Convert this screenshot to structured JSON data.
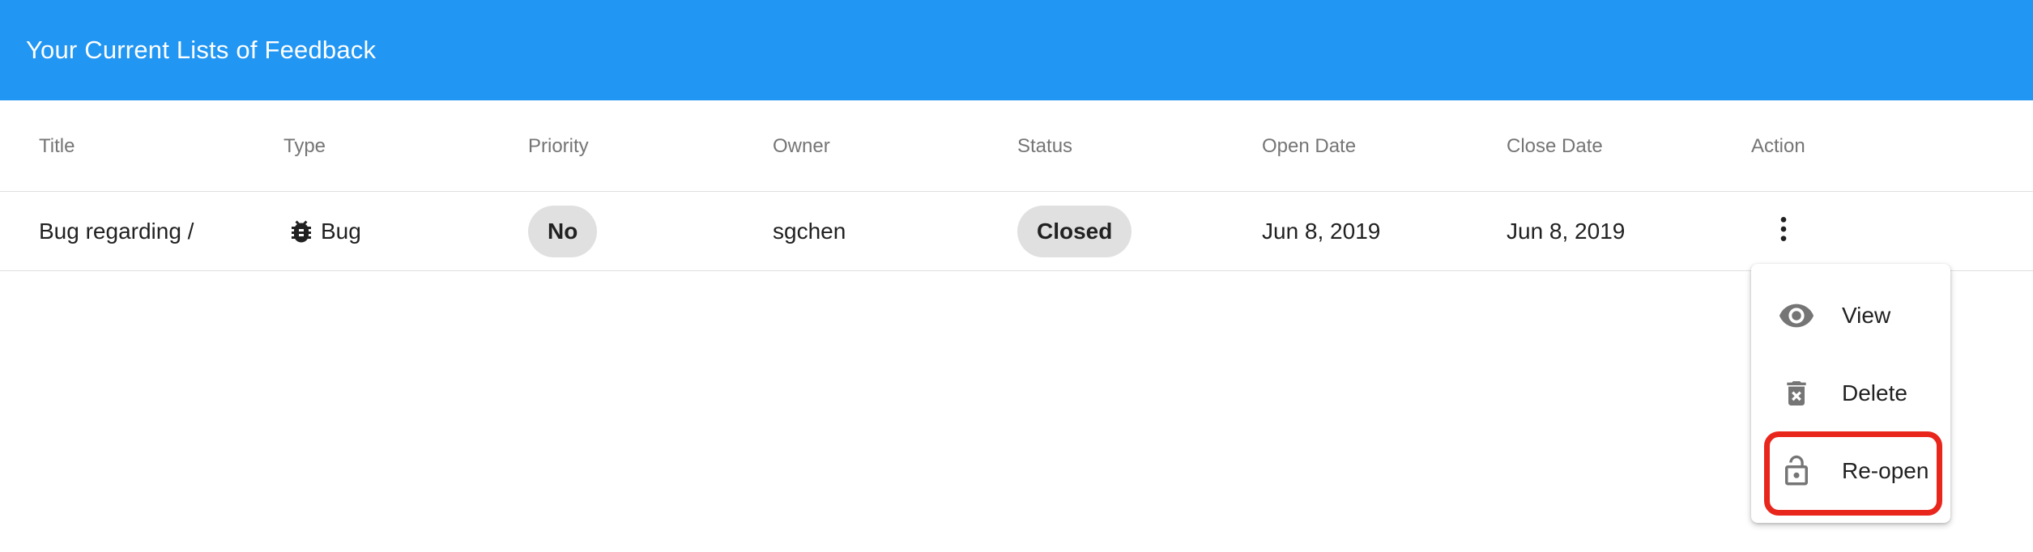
{
  "header": {
    "title": "Your Current Lists of Feedback"
  },
  "table": {
    "columns": [
      "Title",
      "Type",
      "Priority",
      "Owner",
      "Status",
      "Open Date",
      "Close Date",
      "Action"
    ],
    "rows": [
      {
        "title": "Bug regarding /",
        "type": "Bug",
        "type_icon": "bug-icon",
        "priority": "No",
        "owner": "sgchen",
        "status": "Closed",
        "open_date": "Jun 8, 2019",
        "close_date": "Jun 8, 2019",
        "action_icon": "more-vert-icon"
      }
    ]
  },
  "menu": {
    "items": [
      {
        "label": "View",
        "icon": "eye-icon"
      },
      {
        "label": "Delete",
        "icon": "delete-icon"
      },
      {
        "label": "Re-open",
        "icon": "lock-open-icon"
      }
    ]
  },
  "colors": {
    "app_bar": "#2196f3",
    "chip_bg": "#e0e0e0",
    "highlight": "#e8261c",
    "icon_grey": "#757575"
  }
}
